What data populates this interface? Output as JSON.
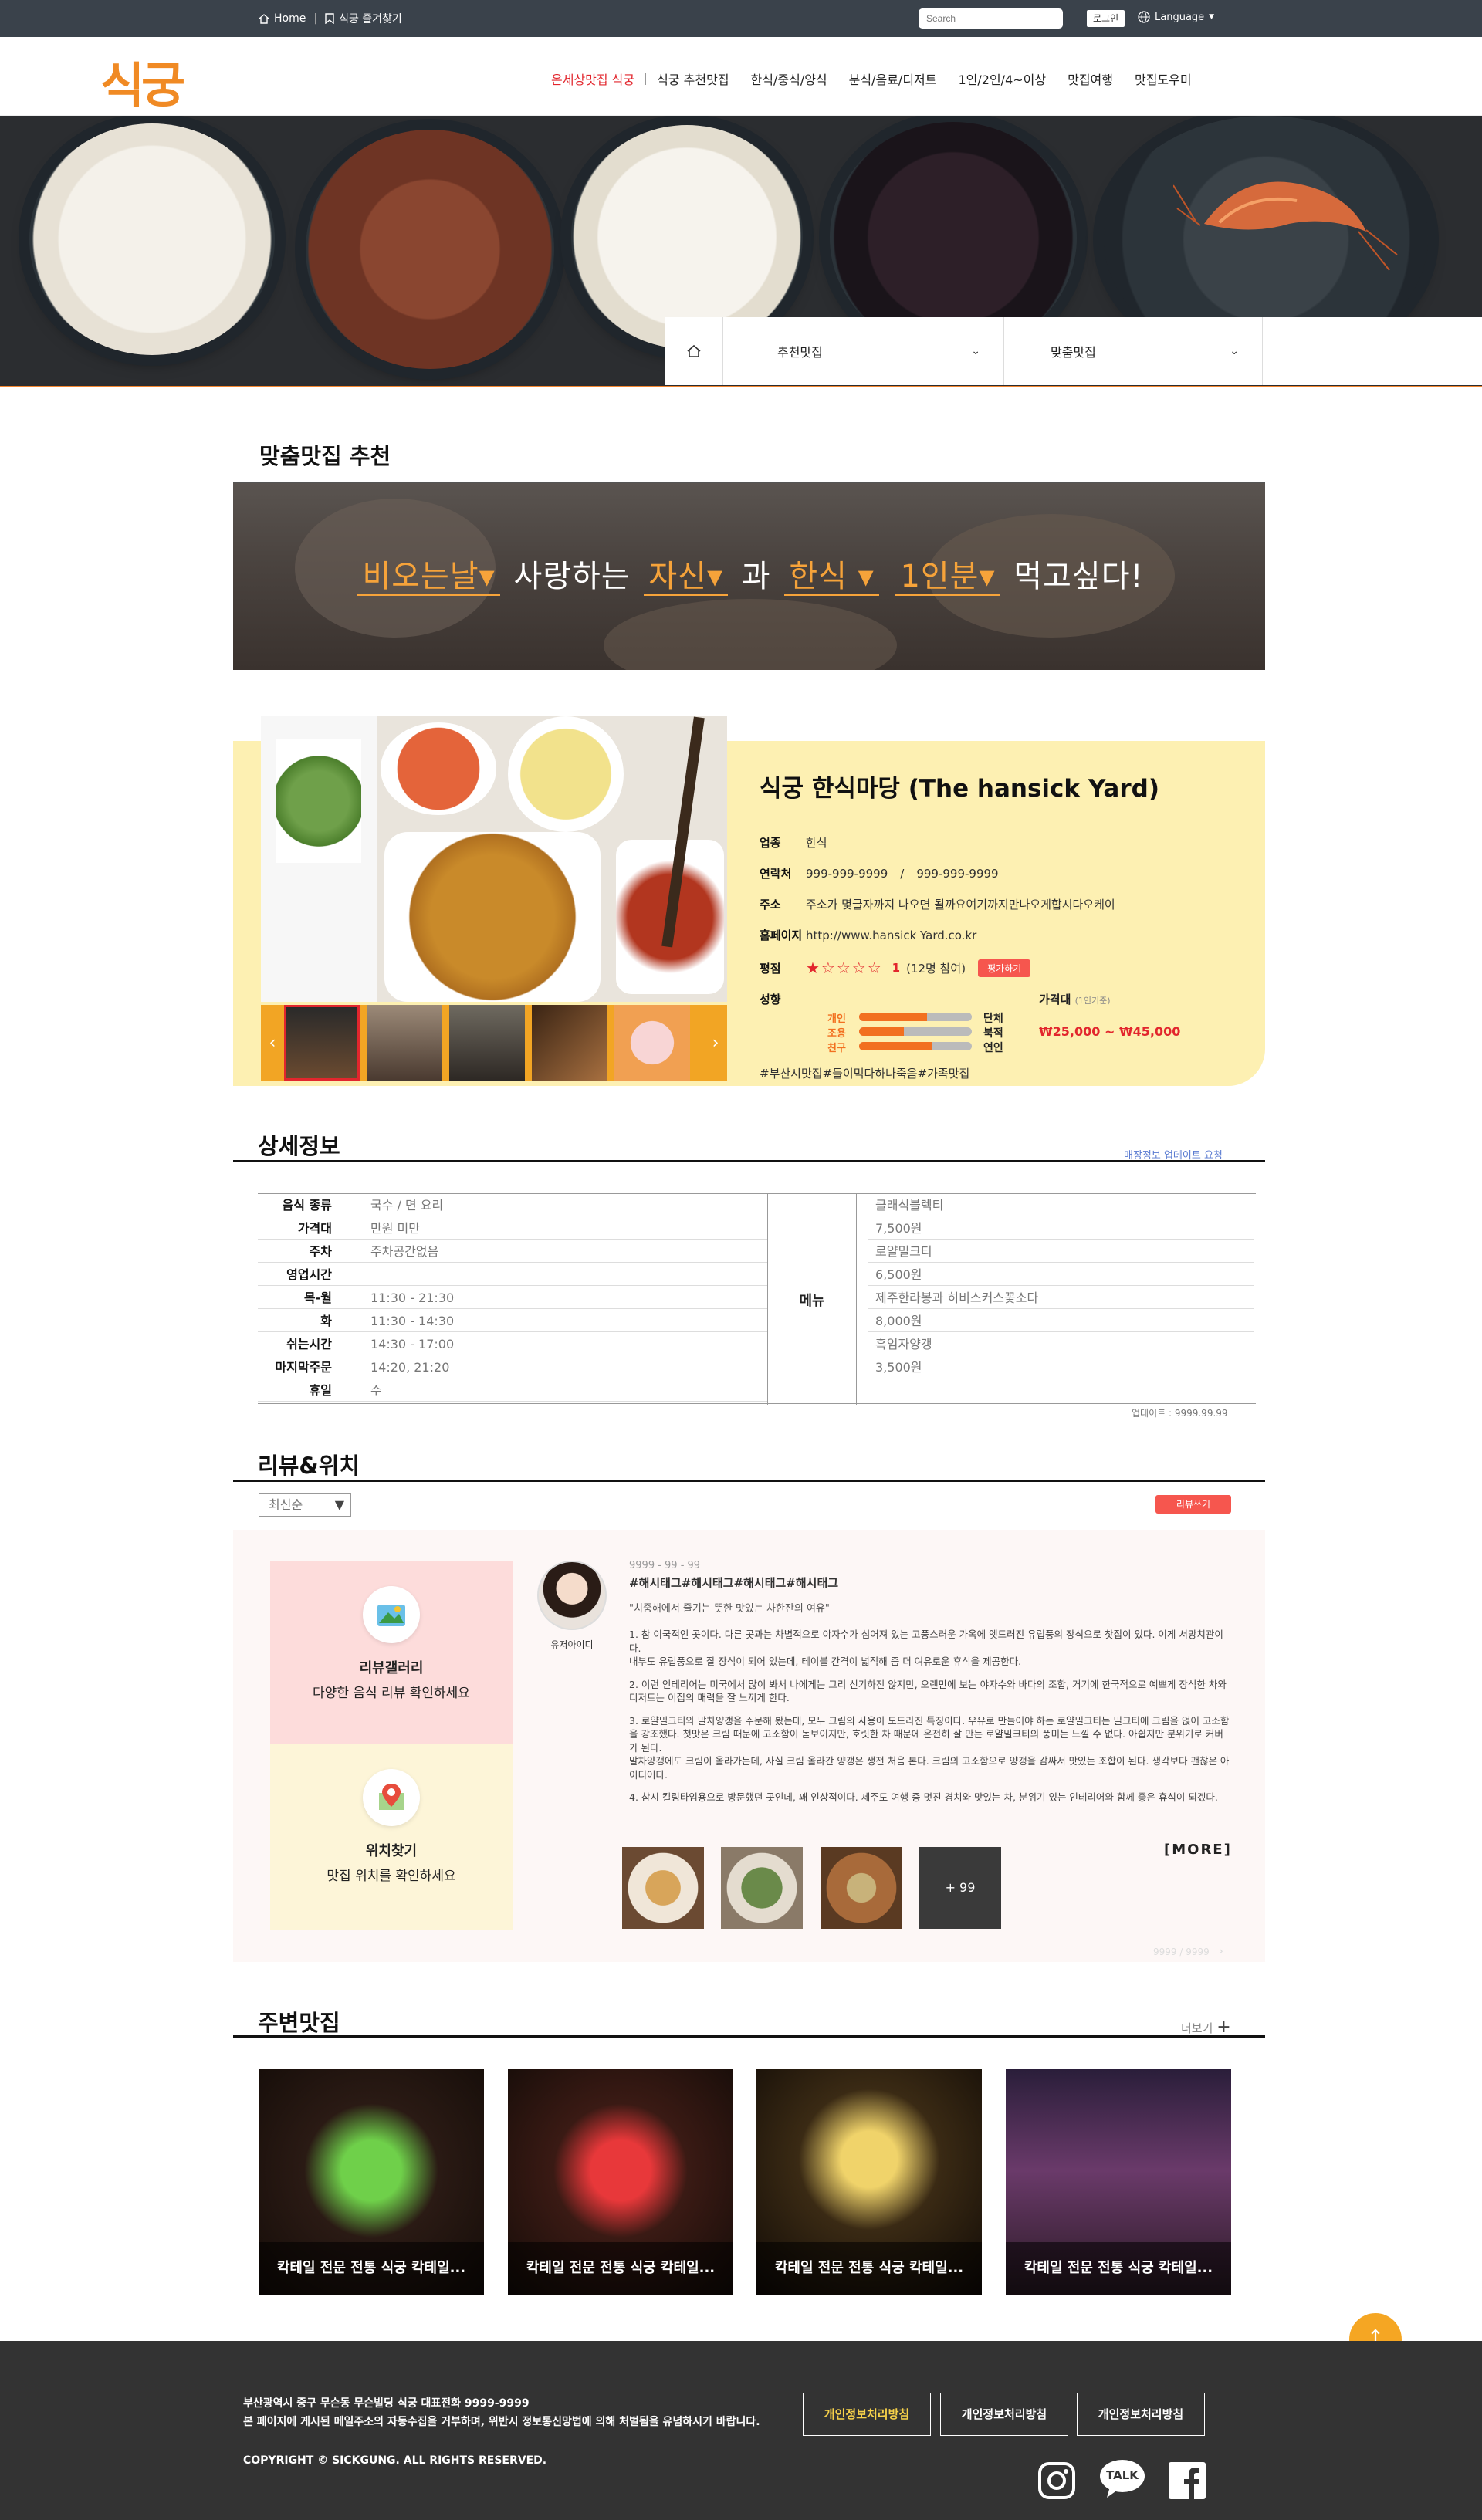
{
  "topbar": {
    "home": "Home",
    "favorite": "식궁 즐겨찾기",
    "search_placeholder": "Search",
    "login": "로그인",
    "language": "Language"
  },
  "header": {
    "logo": "식궁",
    "nav": [
      {
        "label": "온세상맛집 식궁"
      },
      {
        "label": "식궁 추천맛집"
      },
      {
        "label": "한식/중식/양식"
      },
      {
        "label": "분식/음료/디저트"
      },
      {
        "label": "1인/2인/4~이상"
      },
      {
        "label": "맛집여행"
      },
      {
        "label": "맛집도우미"
      }
    ]
  },
  "hero": {
    "dropdown1": "추천맛집",
    "dropdown2": "맞춤맛집"
  },
  "custom": {
    "title": "맞춤맛집 추천",
    "sentence": {
      "weather": "비오는날▾",
      "w1": "사랑하는",
      "person": "자신▾",
      "w2": "과",
      "food": "한식 ▾",
      "count": "1인분▾",
      "w3": "먹고싶다!"
    }
  },
  "restaurant": {
    "name": "식궁 한식마당 (The hansick Yard)",
    "category_label": "업종",
    "category": "한식",
    "contact_label": "연락처",
    "phone1": "999-999-9999",
    "phone_sep": "/",
    "phone2": "999-999-9999",
    "address_label": "주소",
    "address": "주소가 몇글자까지 나오면 될까요여기까지만나오게합시다오케이",
    "homepage_label": "홈페이지",
    "homepage": "http://www.hansick Yard.co.kr",
    "rating_label": "평점",
    "rating_stars": "★☆☆☆☆",
    "rating_value": "1",
    "rating_count": "(12명 참여)",
    "rate_button": "평가하기",
    "tendency_label": "성향",
    "tendencies": [
      {
        "left": "개인",
        "right": "단체",
        "level": 0.6
      },
      {
        "left": "조용",
        "right": "북적",
        "level": 0.4
      },
      {
        "left": "친구",
        "right": "연인",
        "level": 0.65
      }
    ],
    "price_label": "가격대",
    "price_note": "(1인기준)",
    "price": "₩25,000 ~ ₩45,000",
    "tags": "#부산시맛집#들이먹다하나죽음#가족맛집"
  },
  "detail": {
    "title": "상세정보",
    "update_request": "매장정보 업데이트 요청",
    "rows": [
      {
        "k": "음식 종류",
        "v": "국수 / 면 요리"
      },
      {
        "k": "가격대",
        "v": "만원 미만"
      },
      {
        "k": "주차",
        "v": "주차공간없음"
      },
      {
        "k": "영업시간",
        "v": ""
      },
      {
        "k": "목-월",
        "v": "11:30 - 21:30"
      },
      {
        "k": "화",
        "v": "11:30 - 14:30"
      },
      {
        "k": "쉬는시간",
        "v": "14:30 - 17:00"
      },
      {
        "k": "마지막주문",
        "v": "14:20, 21:20"
      },
      {
        "k": "휴일",
        "v": "수"
      }
    ],
    "menu_label": "메뉴",
    "menu": [
      "클래식블렉티",
      "7,500원",
      "로얄밀크티",
      "6,500원",
      "제주한라봉과 히비스커스꽃소다",
      "8,000원",
      "흑임자양갱",
      "3,500원"
    ],
    "updated": "업데이트 : 9999.99.99"
  },
  "review": {
    "title": "리뷰&위치",
    "sort": "최신순",
    "write": "리뷰쓰기",
    "gallery_title": "리뷰갤러리",
    "gallery_desc": "다양한 음식 리뷰 확인하세요",
    "location_title": "위치찾기",
    "location_desc": "맛집 위치를 확인하세요",
    "user": "유저아이디",
    "date": "9999 - 99 - 99",
    "hashtags": "#해시태그#해시태그#해시태그#해시태그",
    "quote": "\"치중해에서 즐기는 뜻한 맛있는 차한잔의 여유\"",
    "paragraphs": [
      "1. 참 이국적인 곳이다. 다른 곳과는 차별적으로 야자수가 심어져 있는 고풍스러운 가옥에 엣드러진 유럽풍의 장식으로 찻집이 있다. 이게 서망치관이다.\n내부도 유럽풍으로 잘 장식이 되어 있는데, 테이블 간격이 넓직해 좀 더 여유로운 휴식을 제공한다.",
      "2. 이런 인테리어는 미국에서 많이 봐서 나에게는 그리 신기하진 않지만, 오랜만에 보는 야자수와 바다의 조합, 거기에 한국적으로 예쁘게 장식한 차와 디저트는 이집의 매력을 잘 느끼게 한다.",
      "3. 로얄밀크티와 말차양갱을 주문해 봤는데, 모두 크림의 사용이 도드라진 특징이다. 우유로 만들어야 하는 로얄밀크티는 밀크티에 크림을 얹어 고소함을 강조했다. 첫맛은 크림 때문에 고소함이 돋보이지만, 호릿한 차 때문에 온전히 잘 만든 로얄밀크티의 풍미는 느낄 수 없다. 아쉽지만 분위기로 커버가 된다.\n말차양갱에도 크림이 올라가는데, 사실 크림 올라간 양갱은 생전 처음 본다. 크림의 고소함으로 양갱을 감싸서 맛있는 조합이 된다. 생각보다 괜찮은 아이디어다.",
      "4. 참시 킬링타임용으로 방문했던 곳인데, 꽤 인상적이다. 제주도 여행 중 멋진 경치와 맛있는 차, 분위기 있는 인테리어와 함께 좋은 휴식이 되겠다."
    ],
    "more": "[MORE]",
    "photo_more": "+ 99",
    "pager": "9999 / 9999"
  },
  "nearby": {
    "title": "주변맛집",
    "more": "더보기",
    "cards": [
      {
        "caption": "칵테일 전문 전통 식궁 칵테일..."
      },
      {
        "caption": "칵테일 전문 전통 식궁 칵테일..."
      },
      {
        "caption": "칵테일 전문 전통 식궁 칵테일..."
      },
      {
        "caption": "칵테일 전문 전통 식궁 칵테일..."
      }
    ]
  },
  "footer": {
    "address": "부산광역시 중구 무슨동 무슨빌딩  식궁   대표전화 9999-9999",
    "notice": "본 페이지에 게시된 메일주소의 자동수집을 거부하며, 위반시 정보통신망법에 의해 처벌됨을 유념하시기 바랍니다.",
    "copyright": "COPYRIGHT © SICKGUNG. ALL RIGHTS RESERVED.",
    "buttons": [
      "개인정보처리방침",
      "개인정보처리방침",
      "개인정보처리방침"
    ],
    "sns_talk": "TALK"
  },
  "colors": {
    "accent": "#f08a24",
    "nav_active": "#e2262d",
    "card_bg": "#fdf0b2",
    "footer_bg": "#333333"
  }
}
